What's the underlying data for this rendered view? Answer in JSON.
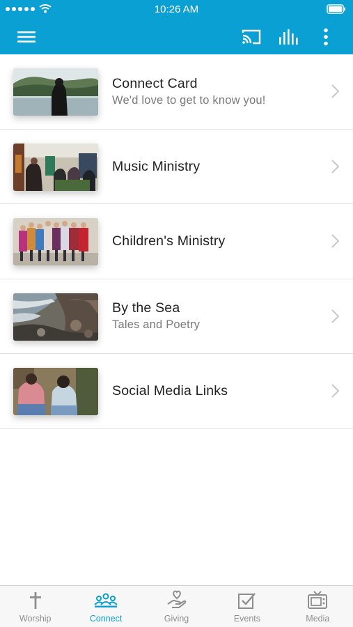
{
  "status_bar": {
    "time": "10:26 AM"
  },
  "colors": {
    "brand": "#0aa0d4",
    "active_tab": "#0b9fd1",
    "inactive_tab": "#8e8e8e"
  },
  "nav": {
    "icons": [
      "menu-icon",
      "cast-icon",
      "equalizer-icon",
      "more-vertical-icon"
    ]
  },
  "list": [
    {
      "title": "Connect Card",
      "subtitle": "We'd love to get to know you!",
      "image": "woman by lake"
    },
    {
      "title": "Music Ministry",
      "subtitle": "",
      "image": "band performing"
    },
    {
      "title": "Children's Ministry",
      "subtitle": "",
      "image": "group of children"
    },
    {
      "title": "By the Sea",
      "subtitle": "Tales and Poetry",
      "image": "rocky shoreline"
    },
    {
      "title": "Social Media Links",
      "subtitle": "",
      "image": "two friends sitting"
    }
  ],
  "tabs": [
    {
      "label": "Worship",
      "icon": "cross-icon",
      "active": false
    },
    {
      "label": "Connect",
      "icon": "group-icon",
      "active": true
    },
    {
      "label": "Giving",
      "icon": "giving-hand-icon",
      "active": false
    },
    {
      "label": "Events",
      "icon": "checkbox-icon",
      "active": false
    },
    {
      "label": "Media",
      "icon": "tv-icon",
      "active": false
    }
  ]
}
